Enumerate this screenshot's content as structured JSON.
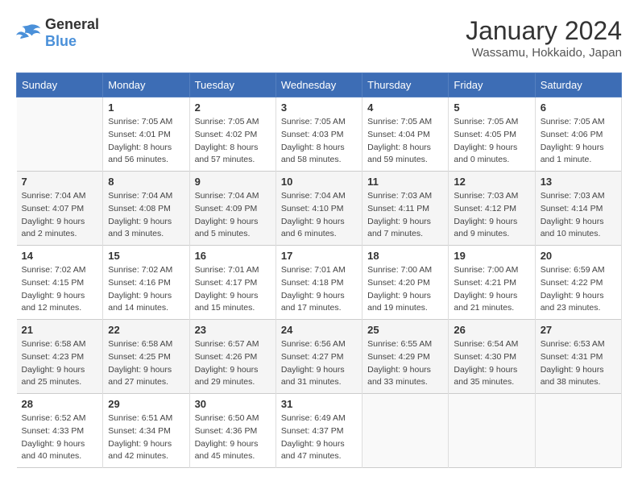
{
  "header": {
    "logo_line1": "General",
    "logo_line2": "Blue",
    "title": "January 2024",
    "subtitle": "Wassamu, Hokkaido, Japan"
  },
  "days_of_week": [
    "Sunday",
    "Monday",
    "Tuesday",
    "Wednesday",
    "Thursday",
    "Friday",
    "Saturday"
  ],
  "weeks": [
    [
      {
        "day": "",
        "sunrise": "",
        "sunset": "",
        "daylight": ""
      },
      {
        "day": "1",
        "sunrise": "Sunrise: 7:05 AM",
        "sunset": "Sunset: 4:01 PM",
        "daylight": "Daylight: 8 hours and 56 minutes."
      },
      {
        "day": "2",
        "sunrise": "Sunrise: 7:05 AM",
        "sunset": "Sunset: 4:02 PM",
        "daylight": "Daylight: 8 hours and 57 minutes."
      },
      {
        "day": "3",
        "sunrise": "Sunrise: 7:05 AM",
        "sunset": "Sunset: 4:03 PM",
        "daylight": "Daylight: 8 hours and 58 minutes."
      },
      {
        "day": "4",
        "sunrise": "Sunrise: 7:05 AM",
        "sunset": "Sunset: 4:04 PM",
        "daylight": "Daylight: 8 hours and 59 minutes."
      },
      {
        "day": "5",
        "sunrise": "Sunrise: 7:05 AM",
        "sunset": "Sunset: 4:05 PM",
        "daylight": "Daylight: 9 hours and 0 minutes."
      },
      {
        "day": "6",
        "sunrise": "Sunrise: 7:05 AM",
        "sunset": "Sunset: 4:06 PM",
        "daylight": "Daylight: 9 hours and 1 minute."
      }
    ],
    [
      {
        "day": "7",
        "sunrise": "Sunrise: 7:04 AM",
        "sunset": "Sunset: 4:07 PM",
        "daylight": "Daylight: 9 hours and 2 minutes."
      },
      {
        "day": "8",
        "sunrise": "Sunrise: 7:04 AM",
        "sunset": "Sunset: 4:08 PM",
        "daylight": "Daylight: 9 hours and 3 minutes."
      },
      {
        "day": "9",
        "sunrise": "Sunrise: 7:04 AM",
        "sunset": "Sunset: 4:09 PM",
        "daylight": "Daylight: 9 hours and 5 minutes."
      },
      {
        "day": "10",
        "sunrise": "Sunrise: 7:04 AM",
        "sunset": "Sunset: 4:10 PM",
        "daylight": "Daylight: 9 hours and 6 minutes."
      },
      {
        "day": "11",
        "sunrise": "Sunrise: 7:03 AM",
        "sunset": "Sunset: 4:11 PM",
        "daylight": "Daylight: 9 hours and 7 minutes."
      },
      {
        "day": "12",
        "sunrise": "Sunrise: 7:03 AM",
        "sunset": "Sunset: 4:12 PM",
        "daylight": "Daylight: 9 hours and 9 minutes."
      },
      {
        "day": "13",
        "sunrise": "Sunrise: 7:03 AM",
        "sunset": "Sunset: 4:14 PM",
        "daylight": "Daylight: 9 hours and 10 minutes."
      }
    ],
    [
      {
        "day": "14",
        "sunrise": "Sunrise: 7:02 AM",
        "sunset": "Sunset: 4:15 PM",
        "daylight": "Daylight: 9 hours and 12 minutes."
      },
      {
        "day": "15",
        "sunrise": "Sunrise: 7:02 AM",
        "sunset": "Sunset: 4:16 PM",
        "daylight": "Daylight: 9 hours and 14 minutes."
      },
      {
        "day": "16",
        "sunrise": "Sunrise: 7:01 AM",
        "sunset": "Sunset: 4:17 PM",
        "daylight": "Daylight: 9 hours and 15 minutes."
      },
      {
        "day": "17",
        "sunrise": "Sunrise: 7:01 AM",
        "sunset": "Sunset: 4:18 PM",
        "daylight": "Daylight: 9 hours and 17 minutes."
      },
      {
        "day": "18",
        "sunrise": "Sunrise: 7:00 AM",
        "sunset": "Sunset: 4:20 PM",
        "daylight": "Daylight: 9 hours and 19 minutes."
      },
      {
        "day": "19",
        "sunrise": "Sunrise: 7:00 AM",
        "sunset": "Sunset: 4:21 PM",
        "daylight": "Daylight: 9 hours and 21 minutes."
      },
      {
        "day": "20",
        "sunrise": "Sunrise: 6:59 AM",
        "sunset": "Sunset: 4:22 PM",
        "daylight": "Daylight: 9 hours and 23 minutes."
      }
    ],
    [
      {
        "day": "21",
        "sunrise": "Sunrise: 6:58 AM",
        "sunset": "Sunset: 4:23 PM",
        "daylight": "Daylight: 9 hours and 25 minutes."
      },
      {
        "day": "22",
        "sunrise": "Sunrise: 6:58 AM",
        "sunset": "Sunset: 4:25 PM",
        "daylight": "Daylight: 9 hours and 27 minutes."
      },
      {
        "day": "23",
        "sunrise": "Sunrise: 6:57 AM",
        "sunset": "Sunset: 4:26 PM",
        "daylight": "Daylight: 9 hours and 29 minutes."
      },
      {
        "day": "24",
        "sunrise": "Sunrise: 6:56 AM",
        "sunset": "Sunset: 4:27 PM",
        "daylight": "Daylight: 9 hours and 31 minutes."
      },
      {
        "day": "25",
        "sunrise": "Sunrise: 6:55 AM",
        "sunset": "Sunset: 4:29 PM",
        "daylight": "Daylight: 9 hours and 33 minutes."
      },
      {
        "day": "26",
        "sunrise": "Sunrise: 6:54 AM",
        "sunset": "Sunset: 4:30 PM",
        "daylight": "Daylight: 9 hours and 35 minutes."
      },
      {
        "day": "27",
        "sunrise": "Sunrise: 6:53 AM",
        "sunset": "Sunset: 4:31 PM",
        "daylight": "Daylight: 9 hours and 38 minutes."
      }
    ],
    [
      {
        "day": "28",
        "sunrise": "Sunrise: 6:52 AM",
        "sunset": "Sunset: 4:33 PM",
        "daylight": "Daylight: 9 hours and 40 minutes."
      },
      {
        "day": "29",
        "sunrise": "Sunrise: 6:51 AM",
        "sunset": "Sunset: 4:34 PM",
        "daylight": "Daylight: 9 hours and 42 minutes."
      },
      {
        "day": "30",
        "sunrise": "Sunrise: 6:50 AM",
        "sunset": "Sunset: 4:36 PM",
        "daylight": "Daylight: 9 hours and 45 minutes."
      },
      {
        "day": "31",
        "sunrise": "Sunrise: 6:49 AM",
        "sunset": "Sunset: 4:37 PM",
        "daylight": "Daylight: 9 hours and 47 minutes."
      },
      {
        "day": "",
        "sunrise": "",
        "sunset": "",
        "daylight": ""
      },
      {
        "day": "",
        "sunrise": "",
        "sunset": "",
        "daylight": ""
      },
      {
        "day": "",
        "sunrise": "",
        "sunset": "",
        "daylight": ""
      }
    ]
  ]
}
